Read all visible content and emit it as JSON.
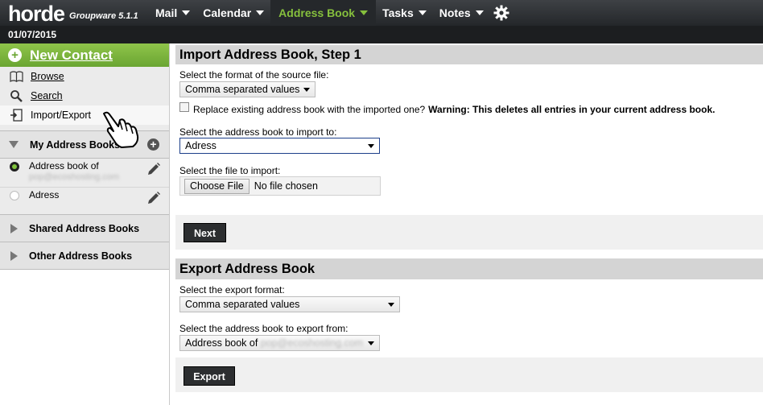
{
  "app": {
    "logo": "horde",
    "version": "Groupware 5.1.1",
    "date": "01/07/2015"
  },
  "menu": [
    {
      "label": "Mail"
    },
    {
      "label": "Calendar"
    },
    {
      "label": "Address Book",
      "active": true
    },
    {
      "label": "Tasks"
    },
    {
      "label": "Notes"
    }
  ],
  "colors": {
    "accent_green": "#86c03d",
    "header_dark": "#2e3134"
  },
  "sidebar": {
    "new_contact": "New Contact",
    "links": [
      {
        "label": "Browse",
        "icon": "book-icon"
      },
      {
        "label": "Search",
        "icon": "search-icon"
      },
      {
        "label": "Import/Export",
        "icon": "import-export-icon"
      }
    ],
    "my_books": "My Address Books",
    "books": [
      {
        "name": "Address book of",
        "owner": "pop@ecoshosting.com",
        "selected": true
      },
      {
        "name": "Adress",
        "owner": "",
        "selected": false
      }
    ],
    "shared": "Shared Address Books",
    "other": "Other Address Books"
  },
  "import": {
    "heading": "Import Address Book, Step 1",
    "format_label": "Select the format of the source file:",
    "format_value": "Comma separated values",
    "replace_text": "Replace existing address book with the imported one?",
    "warning": "Warning: This deletes all entries in your current address book.",
    "book_label": "Select the address book to import to:",
    "book_value": "Adress",
    "file_label": "Select the file to import:",
    "choose_file": "Choose File",
    "no_file": "No file chosen",
    "next": "Next"
  },
  "export": {
    "heading": "Export Address Book",
    "format_label": "Select the export format:",
    "format_value": "Comma separated values",
    "book_label": "Select the address book to export from:",
    "book_value": "Address book of",
    "book_owner": "pop@ecoshosting.com",
    "export": "Export"
  }
}
